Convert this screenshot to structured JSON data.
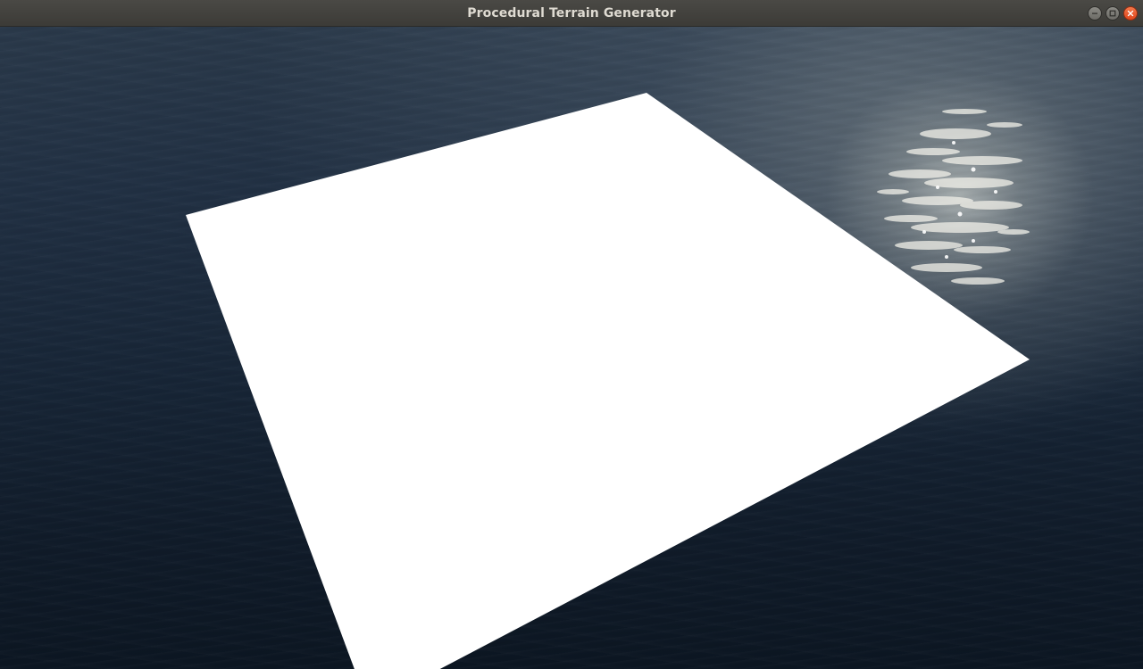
{
  "window": {
    "title": "Procedural Terrain Generator",
    "controls": {
      "minimize_icon": "minimize-icon",
      "maximize_icon": "maximize-icon",
      "close_icon": "close-icon"
    }
  },
  "scene": {
    "water_color": "#182637",
    "sun_glint_color": "#e8e6dc",
    "terrain_plane_color": "#ffffff"
  }
}
